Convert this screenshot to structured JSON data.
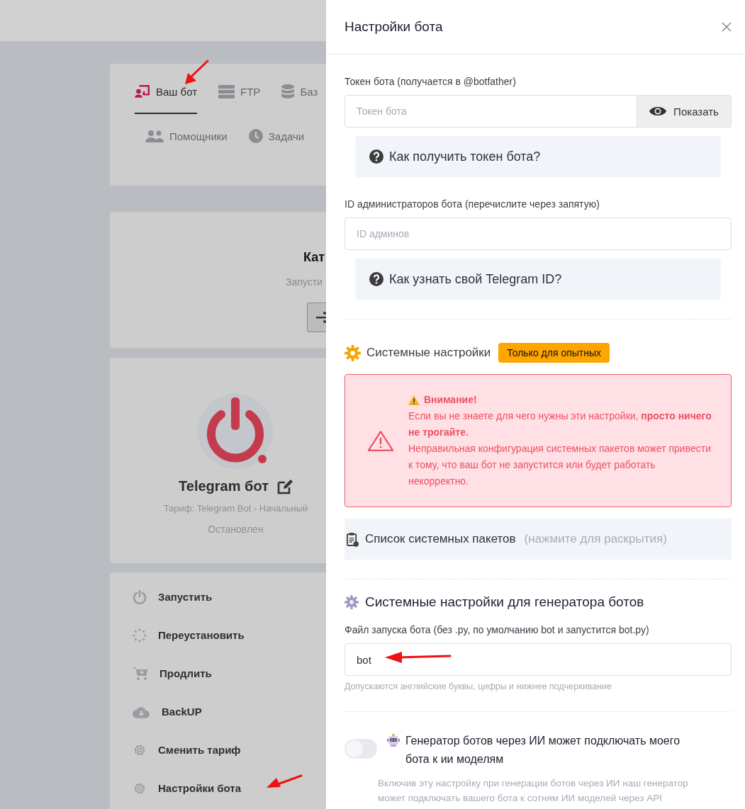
{
  "tabs": [
    {
      "label": "Ваш бот",
      "kind": "bot",
      "selected": true
    },
    {
      "label": "FTP",
      "kind": "server",
      "selected": false
    },
    {
      "label": "Баз",
      "kind": "database",
      "selected": false
    },
    {
      "label": "Помощники",
      "kind": "users",
      "selected": false
    },
    {
      "label": "Задачи",
      "kind": "clock",
      "selected": false
    }
  ],
  "launch_card": {
    "title": "Кат",
    "subtitle": "Запусти"
  },
  "bot_card": {
    "name": "Telegram бот",
    "plan": "Тариф: Telegram Bot - Начальный",
    "status": "Остановлен",
    "running": false
  },
  "actions": [
    {
      "label": "Запустить",
      "kind": "power"
    },
    {
      "label": "Переустановить",
      "kind": "spinner"
    },
    {
      "label": "Продлить",
      "kind": "cart"
    },
    {
      "label": "BackUP",
      "kind": "cloud"
    },
    {
      "label": "Сменить тариф",
      "kind": "gear"
    },
    {
      "label": "Настройки бота",
      "kind": "gear"
    }
  ],
  "drawer": {
    "title": "Настройки бота",
    "token": {
      "label": "Токен бота (получается в @botfather)",
      "placeholder": "Токен бота",
      "button": "Показать",
      "help": "Как получить токен бота?"
    },
    "admins": {
      "label": "ID администраторов бота (перечислите через запятую)",
      "placeholder": "ID админов",
      "help": "Как узнать свой Telegram ID?"
    },
    "system": {
      "title": "Системные настройки",
      "badge": "Только для опытных",
      "alert": {
        "title": "Внимание!",
        "text": "Если вы не знаете для чего нужны эти настройки, **просто ничего не трогайте.**",
        "text2": "Неправильная конфигурация системных пакетов может привести к тому, что ваш бот не запустится или будет работать некорректно."
      },
      "packages": {
        "title": "Список системных пакетов",
        "hint": "(нажмите для раскрытия)",
        "expanded": false
      }
    },
    "generator": {
      "title": "Системные настройки для генератора ботов",
      "file_label": "Файл запуска бота (без .py, по умолчанию bot и запустится bot.py)",
      "file_value": "bot",
      "file_hint": "Допускаются английские буквы, цифры и нижнее подчеркивание",
      "ai_toggle": {
        "label": "Генератор ботов через ИИ может подключать моего бота к ии моделям",
        "on": false,
        "description": "Включив эту настройку при генерации ботов через ИИ наш генератор может подключать вашего бота к сотням ИИ моделей через API"
      }
    }
  }
}
